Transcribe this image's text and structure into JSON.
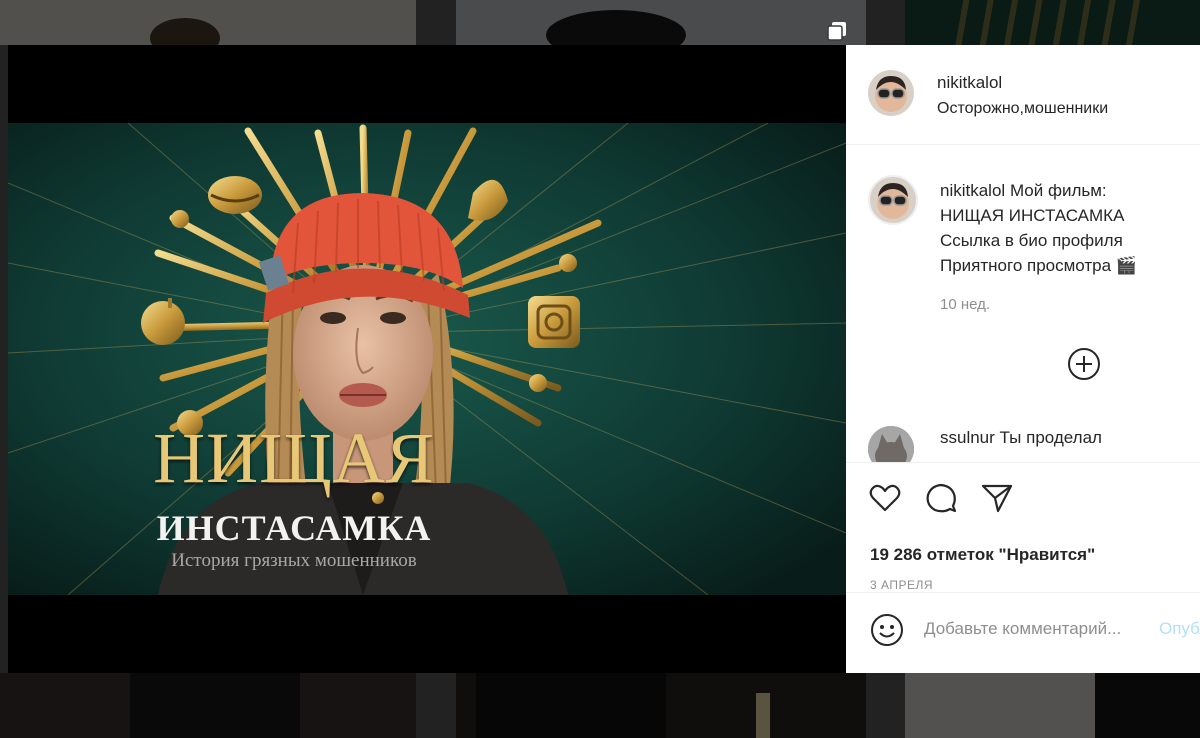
{
  "post": {
    "username": "nikitkalol",
    "location": "Осторожно,мошенники",
    "poster": {
      "title": "НИЩАЯ",
      "subtitle": "ИНСТАСАМКА",
      "tagline": "История грязных мошенников"
    },
    "caption": {
      "username": "nikitkalol",
      "lines": [
        "Мой фильм:",
        "НИЩАЯ ИНСТАСАМКА",
        "Ссылка в био профиля",
        "Приятного просмотра 🎬"
      ],
      "time": "10 нед."
    },
    "comments": [
      {
        "username": "ssulnur",
        "text": "Ты проделал"
      }
    ],
    "likes": "19 286 отметок \"Нравится\"",
    "date": "3 АПРЕЛЯ",
    "add_comment": {
      "placeholder": "Добавьте комментарий...",
      "post_label": "Опубликовать"
    }
  },
  "colors": {
    "poster_bg": "#0f3a33",
    "gold": "#d9b45a",
    "beanie": "#e2553a",
    "post_button": "#b2dffc"
  }
}
